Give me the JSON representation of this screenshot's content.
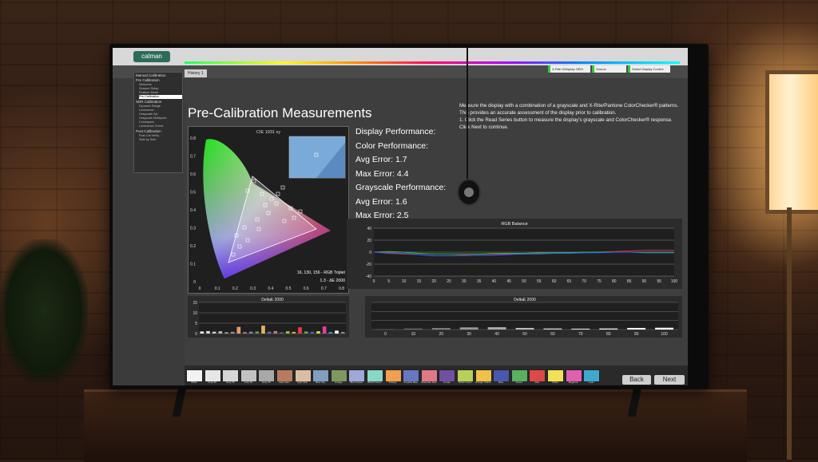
{
  "app": {
    "logo": "calman",
    "tab_label": "History 1",
    "dropdowns": [
      "X-Rite i1Display OEM",
      "Source",
      "Select Display Control"
    ]
  },
  "sidebar": {
    "sections": [
      {
        "label": "Manual Calibration",
        "items": []
      },
      {
        "label": "Pre Calibration",
        "items": [
          "Welcome",
          "Session Setup",
          "Position Meter",
          "Pre-Calibration"
        ]
      },
      {
        "label": "SDR Calibration",
        "items": [
          "Dynamic Range",
          "Luminance",
          "Grayscale 2pt",
          "Grayscale Multipoint",
          "Colorspace",
          "Luminance Check"
        ]
      },
      {
        "label": "Post Calibration",
        "items": [
          "Post-Cal Verify",
          "Side by Side"
        ]
      }
    ],
    "selected": "Pre-Calibration"
  },
  "page": {
    "title": "Pre-Calibration Measurements",
    "instructions": [
      "Measure the display with a combination of a grayscale and X-Rite/Pantone ColorChecker® patterns.",
      "This provides an accurate assessment of the display prior to calibration.",
      "1. Click the Read Series button to measure the display's grayscale and ColorChecker® response.",
      "Click Next to continue."
    ]
  },
  "performance": {
    "display_label": "Display Performance:",
    "color_label": "Color Performance:",
    "color_avg": "Avg Error: 1.7",
    "color_max": "Max Error: 4.4",
    "gray_label": "Grayscale Performance:",
    "gray_avg": "Avg Error: 1.6",
    "gray_max": "Max Error: 2.5"
  },
  "cie": {
    "title": "CIE 1931 xy",
    "triplet": "16, 130, 156 - RGB Triplet",
    "delta": "1.3 - ΔE 2000",
    "x_ticks": [
      "0",
      "0.1",
      "0.2",
      "0.3",
      "0.4",
      "0.5",
      "0.6",
      "0.7",
      "0.8"
    ],
    "y_ticks": [
      "0",
      "0.1",
      "0.2",
      "0.3",
      "0.4",
      "0.5",
      "0.6",
      "0.7",
      "0.8"
    ]
  },
  "chart_data": [
    {
      "type": "line",
      "title": "RGB Balance",
      "x": [
        0,
        5,
        10,
        15,
        20,
        25,
        30,
        35,
        40,
        45,
        50,
        55,
        60,
        65,
        70,
        75,
        80,
        85,
        90,
        95,
        100
      ],
      "ylim": [
        -40,
        40
      ],
      "y_ticks": [
        "40",
        "20",
        "0",
        "-20",
        "-40"
      ],
      "x_ticks": [
        "0",
        "5",
        "10",
        "15",
        "20",
        "25",
        "30",
        "35",
        "40",
        "45",
        "50",
        "55",
        "60",
        "65",
        "70",
        "75",
        "80",
        "85",
        "90",
        "95",
        "100"
      ],
      "series": [
        {
          "color": "#e03030",
          "values": [
            0,
            -2,
            -3,
            -4,
            -6,
            -6,
            -5,
            -5,
            -4,
            -3,
            -3,
            -2,
            -2,
            -1,
            -1,
            0,
            1,
            2,
            3,
            3,
            3
          ]
        },
        {
          "color": "#30c040",
          "values": [
            0,
            1,
            0,
            -2,
            -3,
            -3,
            -3,
            -3,
            -2,
            -2,
            -2,
            -1,
            -1,
            -1,
            0,
            0,
            0,
            0,
            -1,
            -1,
            -1
          ]
        },
        {
          "color": "#3060ff",
          "values": [
            0,
            -1,
            -2,
            -4,
            -6,
            -6,
            -6,
            -5,
            -5,
            -4,
            -3,
            -3,
            -2,
            -2,
            -1,
            -1,
            0,
            0,
            0,
            0,
            0
          ]
        }
      ]
    },
    {
      "type": "bar",
      "title": "DeltaE 2000",
      "ylim": [
        0,
        15
      ],
      "y_ticks": [
        "15",
        "10",
        "5",
        "0"
      ],
      "values": [
        1.0,
        1.2,
        0.9,
        1.1,
        0.6,
        0.8,
        3.2,
        0.7,
        0.9,
        1.0,
        3.8,
        0.9,
        1.2,
        0.6,
        1.1,
        0.8,
        3.0,
        1.0,
        0.9,
        1.1,
        3.4,
        0.7,
        1.4,
        0.8
      ],
      "colors": [
        "#eeeeee",
        "#d8d8d8",
        "#cccccc",
        "#bbbbbb",
        "#aaaaaa",
        "#999999",
        "#e0a070",
        "#c08060",
        "#6a8ac8",
        "#6a9a40",
        "#e8b060",
        "#7060c0",
        "#d07090",
        "#6060a0",
        "#a0c040",
        "#e0a040",
        "#e04040",
        "#60a060",
        "#4060c0",
        "#e0e040",
        "#e040a0",
        "#40a0c0",
        "#ffffff",
        "#888888"
      ]
    },
    {
      "type": "bar",
      "title": "DeltaE 2000",
      "x_ticks": [
        "0",
        "10",
        "20",
        "30",
        "40",
        "50",
        "60",
        "70",
        "80",
        "90",
        "100"
      ],
      "values": [
        0.3,
        0.6,
        0.8,
        1.2,
        1.3,
        0.9,
        0.6,
        0.5,
        0.6,
        0.9,
        1.0
      ],
      "colors": [
        "#555555",
        "#666666",
        "#888888",
        "#999999",
        "#aaaaaa",
        "#bbbbbb",
        "#cccccc",
        "#dddddd",
        "#e8e8e8",
        "#f4f4f4",
        "#ffffff"
      ]
    }
  ],
  "palette": {
    "swatches": [
      {
        "color": "#f2f2f2",
        "label": "White"
      },
      {
        "color": "#e6e6e6",
        "label": "Gray 80"
      },
      {
        "color": "#d6d6d6",
        "label": "Gray 65"
      },
      {
        "color": "#c2c2c2",
        "label": "Gray 50"
      },
      {
        "color": "#a8a8a8",
        "label": "Gray 35"
      },
      {
        "color": "#b87a60",
        "label": "Dark Skin"
      },
      {
        "color": "#dcbca4",
        "label": "Light Skin"
      },
      {
        "color": "#7f9ec0",
        "label": "Blue Sky"
      },
      {
        "color": "#7f9860",
        "label": "Foliage"
      },
      {
        "color": "#a0a8d8",
        "label": "Blue Flower"
      },
      {
        "color": "#88d8c8",
        "label": "Bluish Green"
      },
      {
        "color": "#f0a050",
        "label": "Orange"
      },
      {
        "color": "#6878c0",
        "label": "Purplish Blue"
      },
      {
        "color": "#e07888",
        "label": "Moderate Red"
      },
      {
        "color": "#7050a0",
        "label": "Purple"
      },
      {
        "color": "#b8d058",
        "label": "Yellow Green"
      },
      {
        "color": "#f0c048",
        "label": "Orange Yellow"
      },
      {
        "color": "#4858b0",
        "label": "Blue"
      },
      {
        "color": "#58b060",
        "label": "Green"
      },
      {
        "color": "#e04848",
        "label": "Red"
      },
      {
        "color": "#f0e058",
        "label": "Yellow"
      },
      {
        "color": "#e060b0",
        "label": "Magenta"
      },
      {
        "color": "#40a8d0",
        "label": "Cyan"
      }
    ],
    "back_label": "Back",
    "next_label": "Next"
  }
}
